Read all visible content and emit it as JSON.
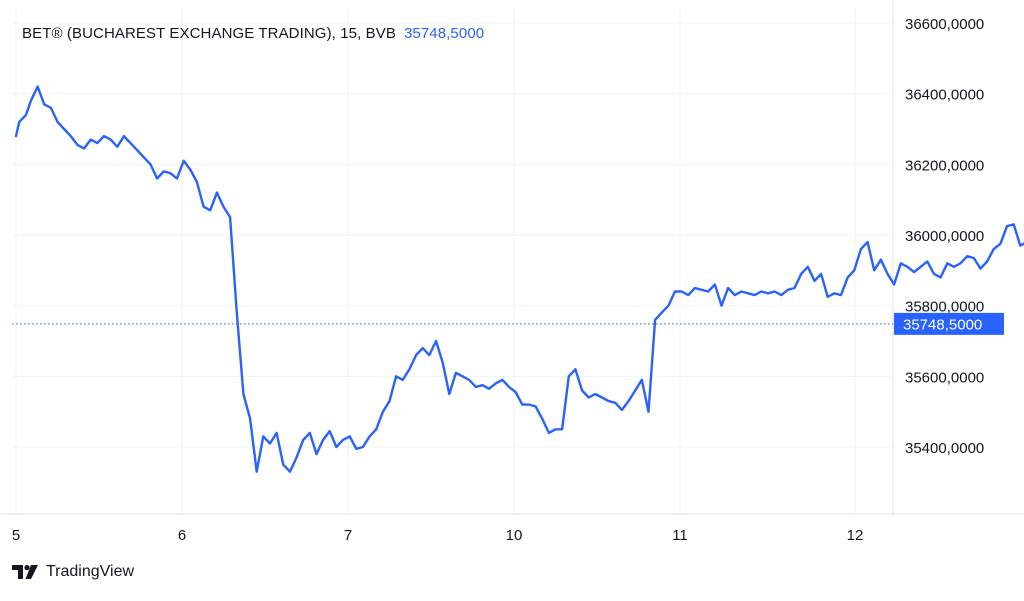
{
  "legend": {
    "symbol": "BET® (BUCHAREST EXCHANGE TRADING), 15, BVB",
    "last_price": "35748,5000"
  },
  "brand": {
    "name": "TradingView",
    "logo_icon": "tradingview-logo-icon"
  },
  "colors": {
    "line": "#2962ff",
    "grid": "#f0f3fa",
    "axis_text": "#131722",
    "label_bg": "#2962ff"
  },
  "chart_data": {
    "type": "line",
    "title": "BET® (BUCHAREST EXCHANGE TRADING), 15, BVB",
    "xlabel": "",
    "ylabel": "",
    "x_ticks": [
      "5",
      "6",
      "7",
      "10",
      "11",
      "12"
    ],
    "y_ticks": [
      "35400,0000",
      "35600,0000",
      "35800,0000",
      "36000,0000",
      "36200,0000",
      "36400,0000",
      "36600,0000"
    ],
    "ylim": [
      35250,
      36650
    ],
    "grid": true,
    "last_value": 35748.5,
    "last_value_label": "35748,5000",
    "series": [
      {
        "values": [
          [
            5.0,
            36280
          ],
          [
            5.02,
            36320
          ],
          [
            5.06,
            36340
          ],
          [
            5.09,
            36380
          ],
          [
            5.13,
            36420
          ],
          [
            5.17,
            36370
          ],
          [
            5.21,
            36360
          ],
          [
            5.25,
            36320
          ],
          [
            5.29,
            36300
          ],
          [
            5.33,
            36280
          ],
          [
            5.37,
            36255
          ],
          [
            5.41,
            36245
          ],
          [
            5.45,
            36270
          ],
          [
            5.49,
            36260
          ],
          [
            5.53,
            36280
          ],
          [
            5.57,
            36270
          ],
          [
            5.61,
            36250
          ],
          [
            5.65,
            36280
          ],
          [
            5.69,
            36260
          ],
          [
            5.73,
            36240
          ],
          [
            5.77,
            36220
          ],
          [
            5.81,
            36200
          ],
          [
            5.85,
            36160
          ],
          [
            5.89,
            36180
          ],
          [
            5.93,
            36175
          ],
          [
            5.97,
            36160
          ],
          [
            6.01,
            36210
          ],
          [
            6.05,
            36185
          ],
          [
            6.09,
            36150
          ],
          [
            6.13,
            36080
          ],
          [
            6.17,
            36070
          ],
          [
            6.21,
            36120
          ],
          [
            6.25,
            36080
          ],
          [
            6.29,
            36050
          ],
          [
            6.33,
            35780
          ],
          [
            6.37,
            35550
          ],
          [
            6.41,
            35480
          ],
          [
            6.45,
            35330
          ],
          [
            6.49,
            35430
          ],
          [
            6.53,
            35410
          ],
          [
            6.57,
            35440
          ],
          [
            6.61,
            35350
          ],
          [
            6.65,
            35330
          ],
          [
            6.69,
            35370
          ],
          [
            6.73,
            35420
          ],
          [
            6.77,
            35440
          ],
          [
            6.81,
            35380
          ],
          [
            6.85,
            35420
          ],
          [
            6.89,
            35445
          ],
          [
            6.93,
            35400
          ],
          [
            6.97,
            35420
          ],
          [
            7.01,
            35430
          ],
          [
            7.05,
            35395
          ],
          [
            7.09,
            35400
          ],
          [
            7.13,
            35430
          ],
          [
            7.17,
            35450
          ],
          [
            7.21,
            35500
          ],
          [
            7.25,
            35530
          ],
          [
            7.29,
            35600
          ],
          [
            7.33,
            35590
          ],
          [
            7.37,
            35620
          ],
          [
            7.41,
            35660
          ],
          [
            7.45,
            35680
          ],
          [
            7.49,
            35660
          ],
          [
            7.53,
            35700
          ],
          [
            7.57,
            35640
          ],
          [
            7.61,
            35550
          ],
          [
            7.65,
            35610
          ],
          [
            7.69,
            35600
          ],
          [
            7.73,
            35590
          ],
          [
            7.77,
            35570
          ],
          [
            7.81,
            35575
          ],
          [
            7.85,
            35565
          ],
          [
            7.89,
            35580
          ],
          [
            7.93,
            35590
          ],
          [
            7.97,
            35570
          ],
          [
            8.01,
            35555
          ],
          [
            8.05,
            35520
          ],
          [
            8.09,
            35520
          ],
          [
            8.13,
            35515
          ],
          [
            8.17,
            35480
          ],
          [
            8.21,
            35440
          ],
          [
            8.25,
            35450
          ],
          [
            8.29,
            35450
          ],
          [
            8.33,
            35600
          ],
          [
            8.37,
            35620
          ],
          [
            8.41,
            35560
          ],
          [
            8.45,
            35540
          ],
          [
            8.49,
            35550
          ],
          [
            8.53,
            35540
          ],
          [
            8.57,
            35530
          ],
          [
            8.61,
            35525
          ],
          [
            8.65,
            35505
          ],
          [
            8.69,
            35530
          ],
          [
            8.73,
            35560
          ],
          [
            8.77,
            35590
          ],
          [
            8.81,
            35500
          ],
          [
            8.85,
            35760
          ],
          [
            8.89,
            35780
          ],
          [
            8.93,
            35800
          ],
          [
            8.97,
            35840
          ],
          [
            9.01,
            35840
          ],
          [
            9.05,
            35830
          ],
          [
            9.09,
            35850
          ],
          [
            9.13,
            35845
          ],
          [
            9.17,
            35840
          ],
          [
            9.21,
            35860
          ],
          [
            9.25,
            35800
          ],
          [
            9.29,
            35850
          ],
          [
            9.33,
            35830
          ],
          [
            9.37,
            35840
          ],
          [
            9.41,
            35835
          ],
          [
            9.45,
            35830
          ],
          [
            9.49,
            35840
          ],
          [
            9.53,
            35835
          ],
          [
            9.57,
            35840
          ],
          [
            9.61,
            35830
          ],
          [
            9.65,
            35845
          ],
          [
            9.69,
            35850
          ],
          [
            9.73,
            35890
          ],
          [
            9.77,
            35910
          ],
          [
            9.81,
            35870
          ],
          [
            9.85,
            35890
          ],
          [
            9.89,
            35825
          ],
          [
            9.93,
            35835
          ],
          [
            9.97,
            35830
          ],
          [
            10.01,
            35880
          ],
          [
            10.05,
            35900
          ],
          [
            10.09,
            35960
          ],
          [
            10.13,
            35980
          ],
          [
            10.17,
            35900
          ],
          [
            10.21,
            35930
          ],
          [
            10.25,
            35890
          ],
          [
            10.29,
            35860
          ],
          [
            10.33,
            35920
          ],
          [
            10.37,
            35910
          ],
          [
            10.41,
            35895
          ],
          [
            10.45,
            35910
          ],
          [
            10.49,
            35925
          ],
          [
            10.53,
            35890
          ],
          [
            10.57,
            35880
          ],
          [
            10.61,
            35920
          ],
          [
            10.65,
            35910
          ],
          [
            10.69,
            35920
          ],
          [
            10.73,
            35940
          ],
          [
            10.77,
            35935
          ],
          [
            10.81,
            35905
          ],
          [
            10.85,
            35925
          ],
          [
            10.89,
            35960
          ],
          [
            10.93,
            35975
          ],
          [
            10.97,
            36025
          ],
          [
            11.01,
            36030
          ],
          [
            11.05,
            35970
          ],
          [
            11.09,
            35980
          ],
          [
            11.13,
            35960
          ],
          [
            11.17,
            35915
          ],
          [
            11.21,
            35900
          ],
          [
            11.25,
            35870
          ],
          [
            11.29,
            35865
          ],
          [
            11.33,
            35940
          ],
          [
            11.37,
            35748.5
          ]
        ]
      }
    ]
  }
}
